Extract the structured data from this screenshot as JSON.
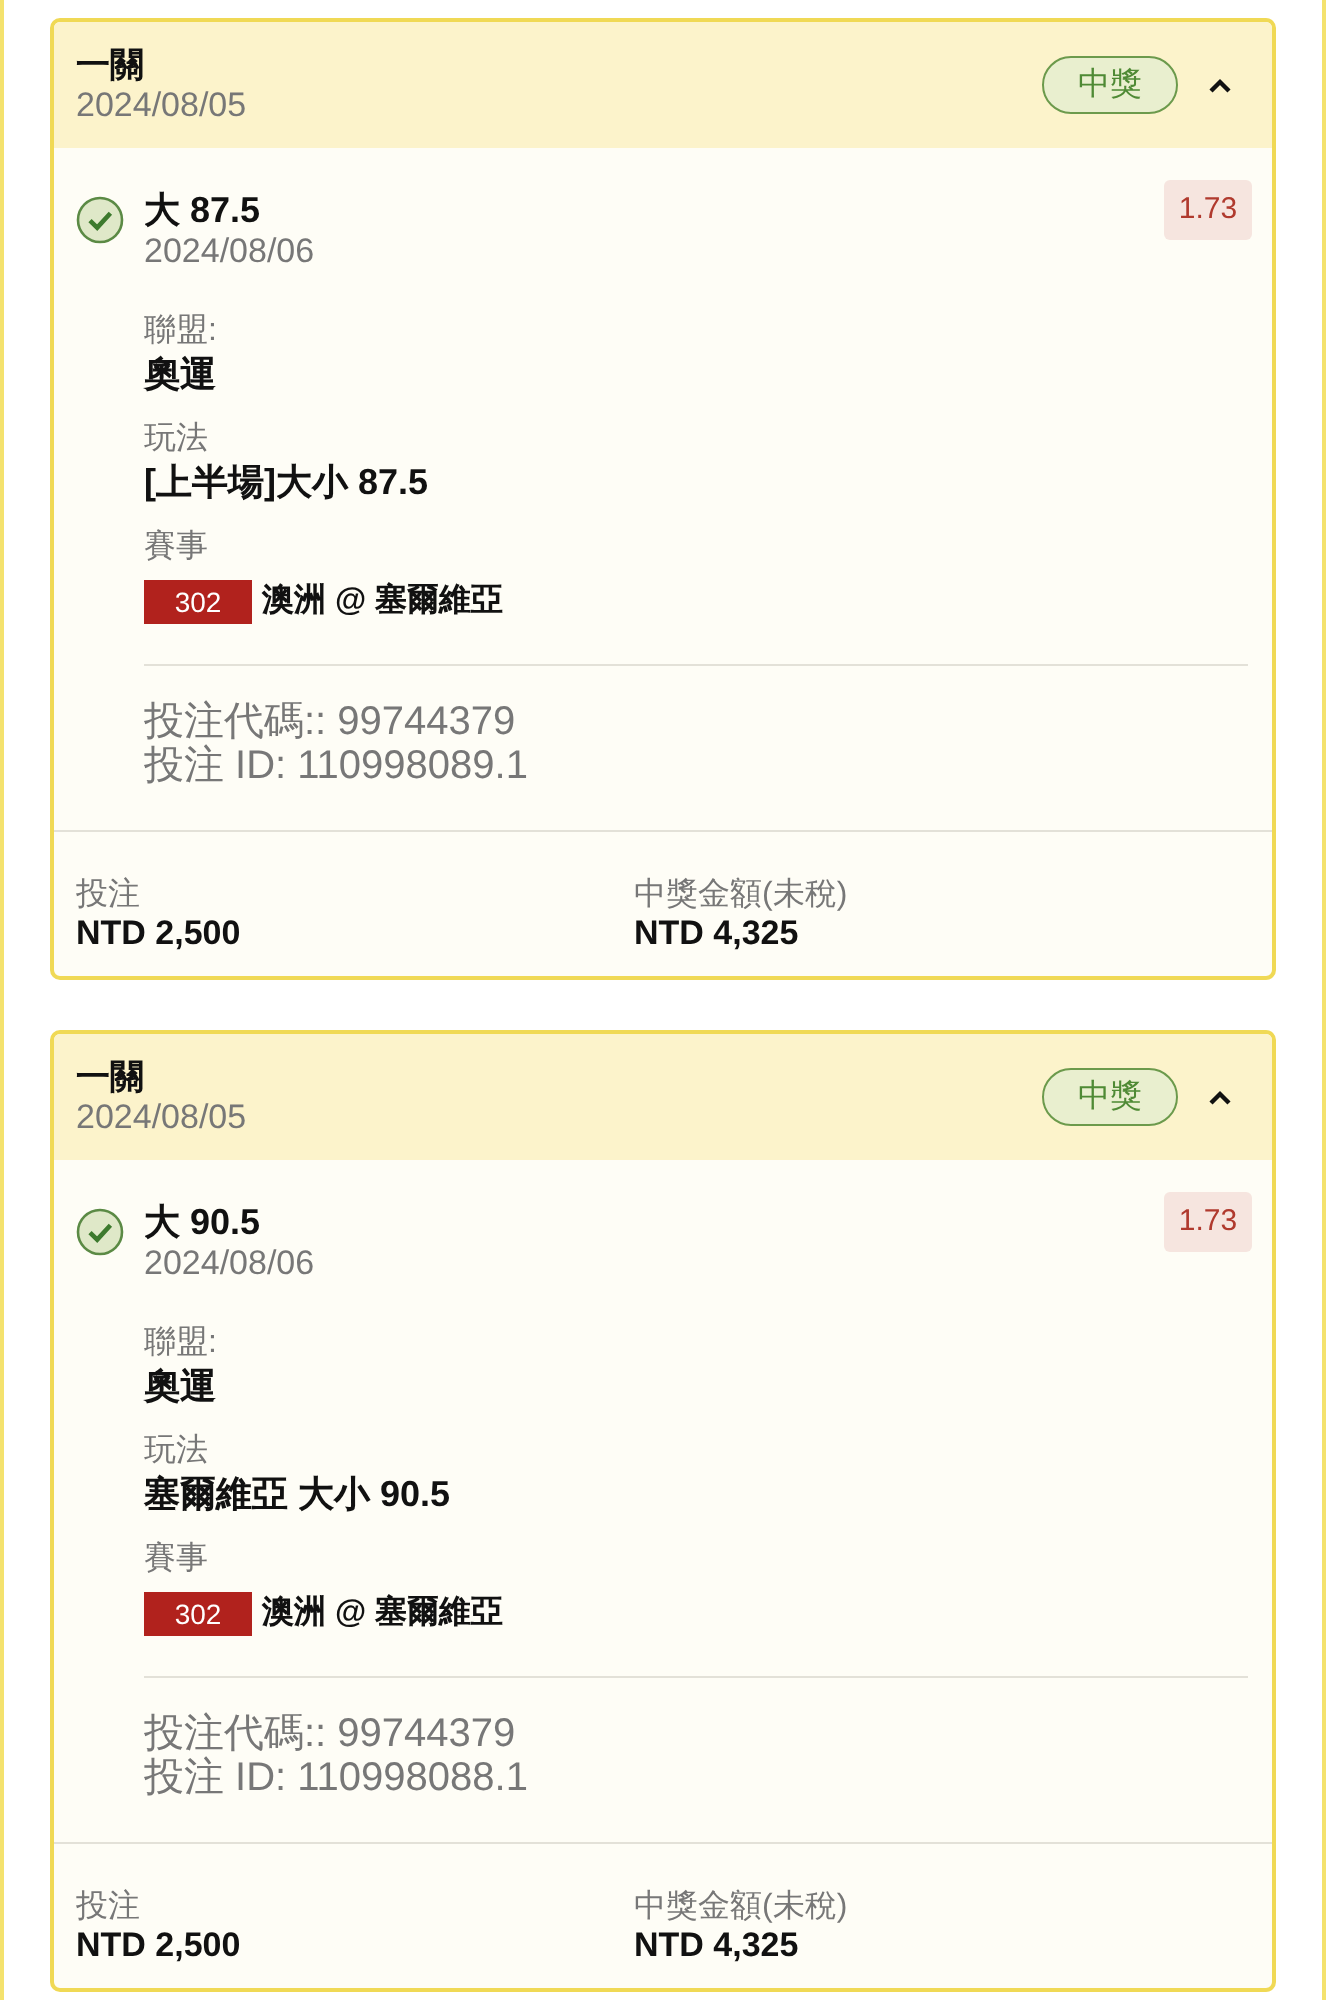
{
  "bets": [
    {
      "type": "一關",
      "date": "2024/08/05",
      "status": {
        "label": "中獎",
        "kind": "won"
      },
      "expanded": true,
      "selection": {
        "won": true,
        "pick": "大 87.5",
        "date": "2024/08/06",
        "odds": "1.73",
        "details": [
          {
            "kind": "text",
            "label": "聯盟:",
            "value": "奧運"
          },
          {
            "kind": "text",
            "label": "玩法",
            "value": "[上半場]大小 87.5"
          },
          {
            "kind": "match",
            "label": "賽事",
            "match_number": "302",
            "value": "澳洲 @ 塞爾維亞"
          }
        ],
        "codes": [
          "投注代碼:: 99744379",
          "投注 ID: 110998089.1"
        ]
      },
      "summary": [
        {
          "label": "投注",
          "value": "NTD 2,500"
        },
        {
          "label": "中獎金額(未稅)",
          "value": "NTD 4,325"
        }
      ]
    },
    {
      "type": "一關",
      "date": "2024/08/05",
      "status": {
        "label": "中獎",
        "kind": "won"
      },
      "expanded": true,
      "selection": {
        "won": true,
        "pick": "大 90.5",
        "date": "2024/08/06",
        "odds": "1.73",
        "details": [
          {
            "kind": "text",
            "label": "聯盟:",
            "value": "奧運"
          },
          {
            "kind": "text",
            "label": "玩法",
            "value": "塞爾維亞 大小 90.5"
          },
          {
            "kind": "match",
            "label": "賽事",
            "match_number": "302",
            "value": "澳洲 @ 塞爾維亞"
          }
        ],
        "codes": [
          "投注代碼:: 99744379",
          "投注 ID: 110998088.1"
        ]
      },
      "summary": [
        {
          "label": "投注",
          "value": "NTD 2,500"
        },
        {
          "label": "中獎金額(未稅)",
          "value": "NTD 4,325"
        }
      ]
    }
  ]
}
